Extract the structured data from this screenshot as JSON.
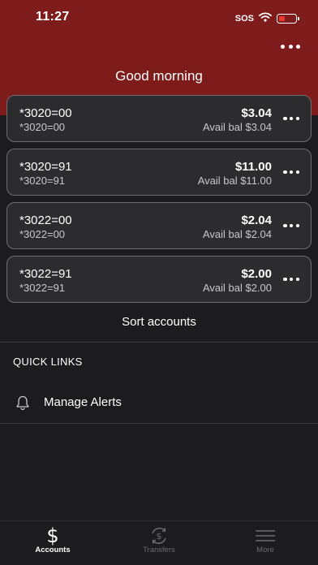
{
  "status_bar": {
    "time": "11:27",
    "sos": "SOS"
  },
  "header": {
    "greeting": "Good morning"
  },
  "accounts": [
    {
      "name": "*3020=00",
      "sub": "*3020=00",
      "balance": "$3.04",
      "available": "Avail bal $3.04"
    },
    {
      "name": "*3020=91",
      "sub": "*3020=91",
      "balance": "$11.00",
      "available": "Avail bal $11.00"
    },
    {
      "name": "*3022=00",
      "sub": "*3022=00",
      "balance": "$2.04",
      "available": "Avail bal $2.04"
    },
    {
      "name": "*3022=91",
      "sub": "*3022=91",
      "balance": "$2.00",
      "available": "Avail bal $2.00"
    }
  ],
  "sort_label": "Sort accounts",
  "quick_links": {
    "title": "QUICK LINKS",
    "items": [
      {
        "label": "Manage Alerts",
        "icon": "bell-icon"
      }
    ]
  },
  "tabbar": {
    "tabs": [
      {
        "label": "Accounts",
        "icon": "dollar-icon",
        "active": true
      },
      {
        "label": "Transfers",
        "icon": "transfer-icon",
        "active": false
      },
      {
        "label": "More",
        "icon": "menu-icon",
        "active": false
      }
    ]
  },
  "colors": {
    "header": "#7e1b1b",
    "background": "#1c1c1e",
    "card": "#2c2c2e",
    "card_border": "#6e6e72"
  }
}
